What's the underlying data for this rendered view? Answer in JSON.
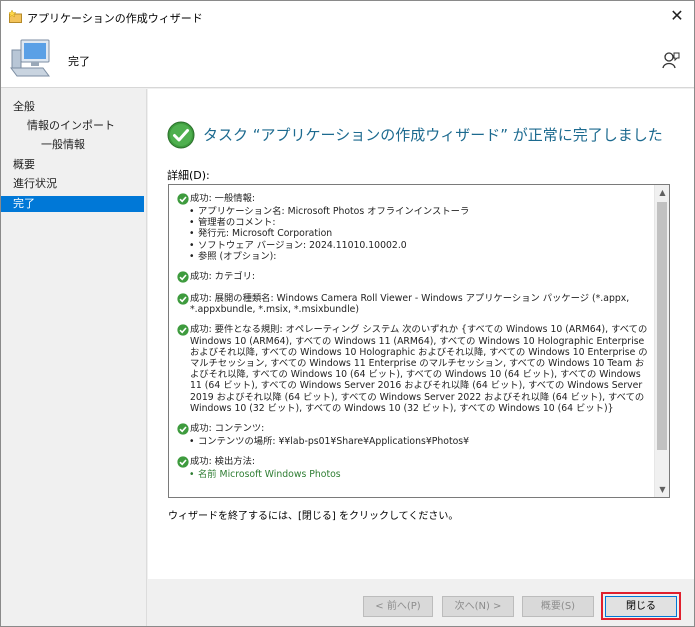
{
  "window": {
    "title": "アプリケーションの作成ウィザード",
    "close_label": "✕"
  },
  "header": {
    "title": "完了"
  },
  "nav": {
    "items": [
      {
        "label": "全般",
        "indent": 0,
        "selected": false
      },
      {
        "label": "情報のインポート",
        "indent": 1,
        "selected": false
      },
      {
        "label": "一般情報",
        "indent": 2,
        "selected": false
      },
      {
        "label": "概要",
        "indent": 0,
        "selected": false
      },
      {
        "label": "進行状況",
        "indent": 0,
        "selected": false
      },
      {
        "label": "完了",
        "indent": 0,
        "selected": true
      }
    ]
  },
  "main": {
    "status_text": "タスク “アプリケーションの作成ウィザード” が正常に完了しました",
    "details_label": "詳細(D):",
    "details": {
      "general": {
        "head": "成功: 一般情報:",
        "lines": [
          "アプリケーション名: Microsoft Photos オフラインインストーラ",
          "管理者のコメント:",
          "発行元: Microsoft Corporation",
          "ソフトウェア バージョン: 2024.11010.10002.0",
          "参照 (オプション):"
        ]
      },
      "category": {
        "head": "成功: カテゴリ:"
      },
      "deployment": {
        "head": "成功: 展開の種類名: Windows Camera Roll Viewer - Windows アプリケーション パッケージ (*.appx, *.appxbundle, *.msix, *.msixbundle)"
      },
      "requirements": {
        "prefix": "成功: 要件となる規則:",
        "text": "オペレーティング システム 次のいずれか {すべての Windows 10 (ARM64), すべての Windows 10 (ARM64), すべての Windows 11 (ARM64), すべての Windows 10 Holographic Enterprise およびそれ以降, すべての Windows 10 Holographic およびそれ以降, すべての Windows 10 Enterprise のマルチセッション, すべての Windows 11 Enterprise のマルチセッション, すべての Windows 10 Team およびそれ以降, すべての Windows 10 (64 ビット), すべての Windows 10 (64 ビット), すべての Windows 11 (64 ビット), すべての Windows Server 2016 およびそれ以降 (64 ビット), すべての Windows Server 2019 およびそれ以降 (64 ビット), すべての Windows Server 2022 およびそれ以降 (64 ビット), すべての Windows 10 (32 ビット), すべての Windows 10 (32 ビット), すべての Windows 10 (64 ビット)}"
      },
      "content": {
        "head": "成功: コンテンツ:",
        "lines": [
          "コンテンツの場所: ¥¥lab-ps01¥Share¥Applications¥Photos¥"
        ]
      },
      "detection": {
        "head": "成功: 検出方法:",
        "lines": [
          "名前 Microsoft Windows Photos"
        ]
      }
    },
    "hint": "ウィザードを終了するには、[閉じる] をクリックしてください。"
  },
  "buttons": {
    "prev": "< 前へ(P)",
    "next": "次へ(N) >",
    "summary": "概要(S)",
    "close": "閉じる"
  },
  "colors": {
    "accent": "#0078d7",
    "success": "#2e8b2e",
    "highlight": "#e0202e",
    "status_text": "#1c6a8f"
  }
}
